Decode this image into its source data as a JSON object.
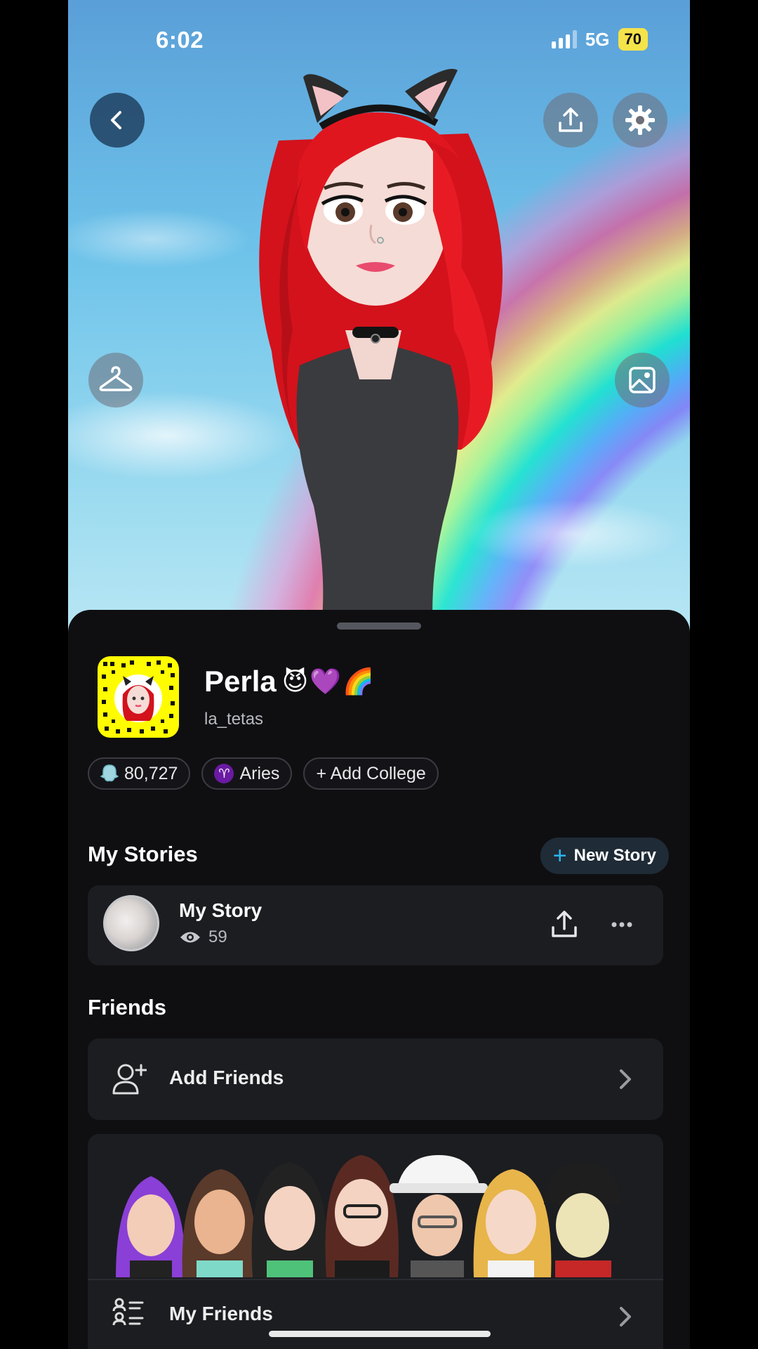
{
  "status_bar": {
    "time": "6:02",
    "network": "5G",
    "battery": "70"
  },
  "header": {
    "back_icon": "chevron-left-icon",
    "share_icon": "upload-icon",
    "settings_icon": "gear-icon",
    "outfit_icon": "hanger-icon",
    "background_icon": "image-icon"
  },
  "profile": {
    "display_name": "Perla",
    "name_emojis": "😈💜🌈",
    "username": "la_tetas",
    "chips": {
      "score": "80,727",
      "zodiac_symbol": "♈",
      "zodiac": "Aries",
      "college": "+ Add College"
    }
  },
  "stories": {
    "title": "My Stories",
    "new_story_label": "New Story",
    "my_story": {
      "title": "My Story",
      "views": "59"
    }
  },
  "friends": {
    "title": "Friends",
    "add_friends_label": "Add Friends",
    "my_friends_label": "My Friends"
  },
  "colors": {
    "snap_yellow": "#fffc00",
    "accent_blue": "#2ab6f5",
    "sheet_bg": "#0f0f12",
    "card_bg": "#1c1d21"
  }
}
